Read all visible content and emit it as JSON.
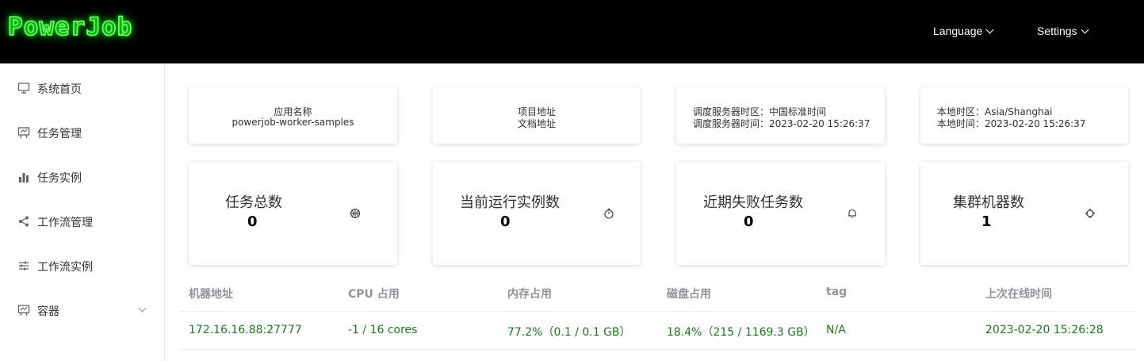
{
  "header": {
    "logo": "PowerJob",
    "language_label": "Language",
    "settings_label": "Settings"
  },
  "sidebar": {
    "items": [
      {
        "label": "系统首页",
        "icon": "monitor-icon"
      },
      {
        "label": "任务管理",
        "icon": "presentation-icon"
      },
      {
        "label": "任务实例",
        "icon": "bar-chart-icon"
      },
      {
        "label": "工作流管理",
        "icon": "share-icon"
      },
      {
        "label": "工作流实例",
        "icon": "sliders-icon"
      },
      {
        "label": "容器",
        "icon": "presentation-icon"
      }
    ]
  },
  "info_cards": {
    "app": {
      "line1": "应用名称",
      "line2": "powerjob-worker-samples"
    },
    "links": {
      "line1": "项目地址",
      "line2": "文档地址"
    },
    "server_time": {
      "line1": "调度服务器时区：中国标准时间",
      "line2": "调度服务器时间：2023-02-20 15:26:37"
    },
    "local_time": {
      "line1": "本地时区：Asia/Shanghai",
      "line2": "本地时间：2023-02-20 15:26:37"
    }
  },
  "stats": [
    {
      "title": "任务总数",
      "value": "0",
      "icon": "basketball-icon"
    },
    {
      "title": "当前运行实例数",
      "value": "0",
      "icon": "stopwatch-icon"
    },
    {
      "title": "近期失败任务数",
      "value": "0",
      "icon": "bell-icon"
    },
    {
      "title": "集群机器数",
      "value": "1",
      "icon": "cog-icon"
    }
  ],
  "table": {
    "columns": [
      "机器地址",
      "CPU 占用",
      "内存占用",
      "磁盘占用",
      "tag",
      "上次在线时间"
    ],
    "rows": [
      [
        "172.16.16.88:27777",
        "-1 / 16 cores",
        "77.2%（0.1 / 0.1 GB）",
        "18.4%（215 / 1169.3 GB）",
        "N/A",
        "2023-02-20 15:26:28"
      ]
    ]
  },
  "colors": {
    "topbar": "#000000",
    "logo_green": "#22ff22",
    "cell_text": "#1b7a1b",
    "header_text": "#909399"
  }
}
